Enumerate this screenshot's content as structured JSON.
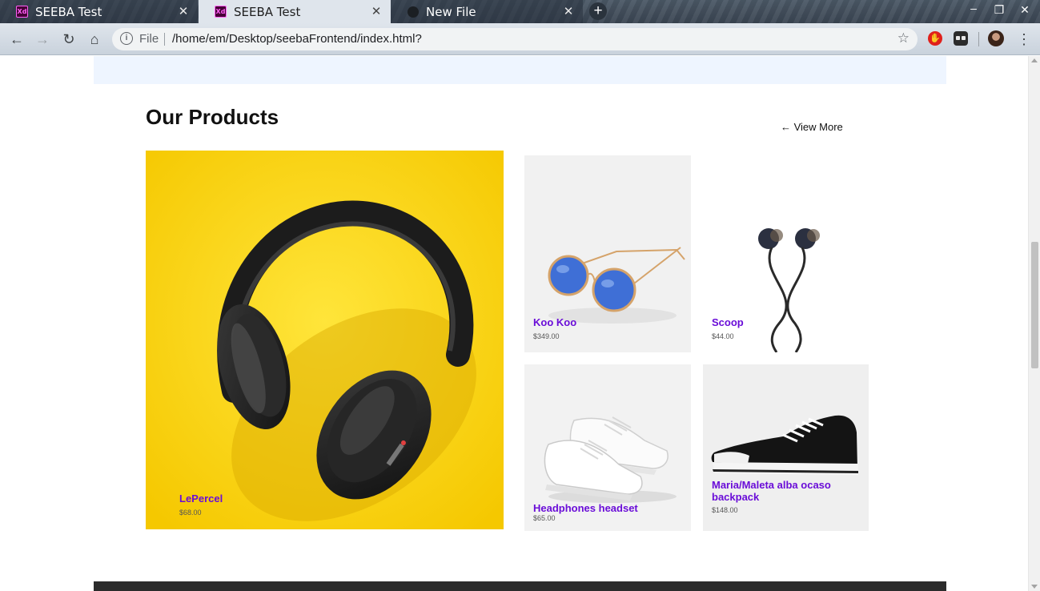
{
  "browser": {
    "tabs": [
      {
        "title": "SEEBA Test",
        "favicon": "adobe-xd-icon",
        "state": "inactive"
      },
      {
        "title": "SEEBA Test",
        "favicon": "adobe-xd-icon",
        "state": "active"
      },
      {
        "title": "New File",
        "favicon": "github-icon",
        "state": "inactive"
      }
    ],
    "new_tab_label": "+",
    "address": {
      "scheme_label": "File",
      "url": "/home/em/Desktop/seebaFrontend/index.html?"
    }
  },
  "page": {
    "section_title": "Our Products",
    "view_more_label": "← View More",
    "products": [
      {
        "id": "featured",
        "name": "LePercel",
        "price": "$68.00",
        "image": "headphones-image"
      },
      {
        "id": "sunglasses",
        "name": "Koo Koo",
        "price": "$349.00",
        "image": "sunglasses-image"
      },
      {
        "id": "earphones",
        "name": "Scoop",
        "price": "$44.00",
        "image": "earphones-image"
      },
      {
        "id": "sneakers",
        "name": "Headphones headset",
        "price": "$65.00",
        "image": "white-sneakers-image"
      },
      {
        "id": "converse",
        "name": "Maria/Maleta alba ocaso backpack",
        "price": "$148.00",
        "image": "black-sneaker-image"
      }
    ]
  },
  "colors": {
    "accent_purple": "#6a0dd8",
    "featured_bg": "#fedb1f",
    "hero_strip": "#eef5ff",
    "footer": "#2b2b2b"
  }
}
